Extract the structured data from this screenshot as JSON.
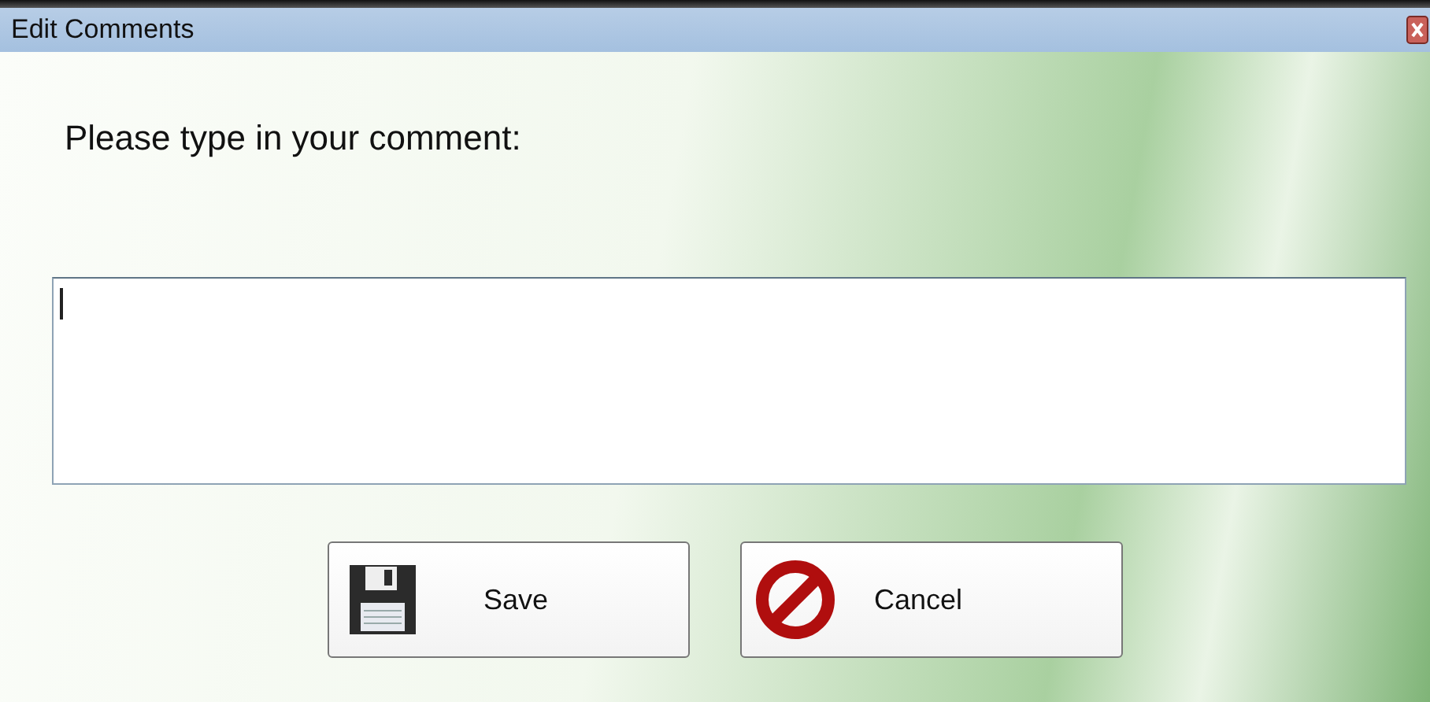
{
  "window": {
    "title": "Edit Comments"
  },
  "prompt": "Please type in your comment:",
  "comment_field": {
    "focused": true
  },
  "buttons": [
    {
      "kind": "save",
      "label": "Save"
    },
    {
      "kind": "cancel",
      "label": "Cancel"
    }
  ]
}
